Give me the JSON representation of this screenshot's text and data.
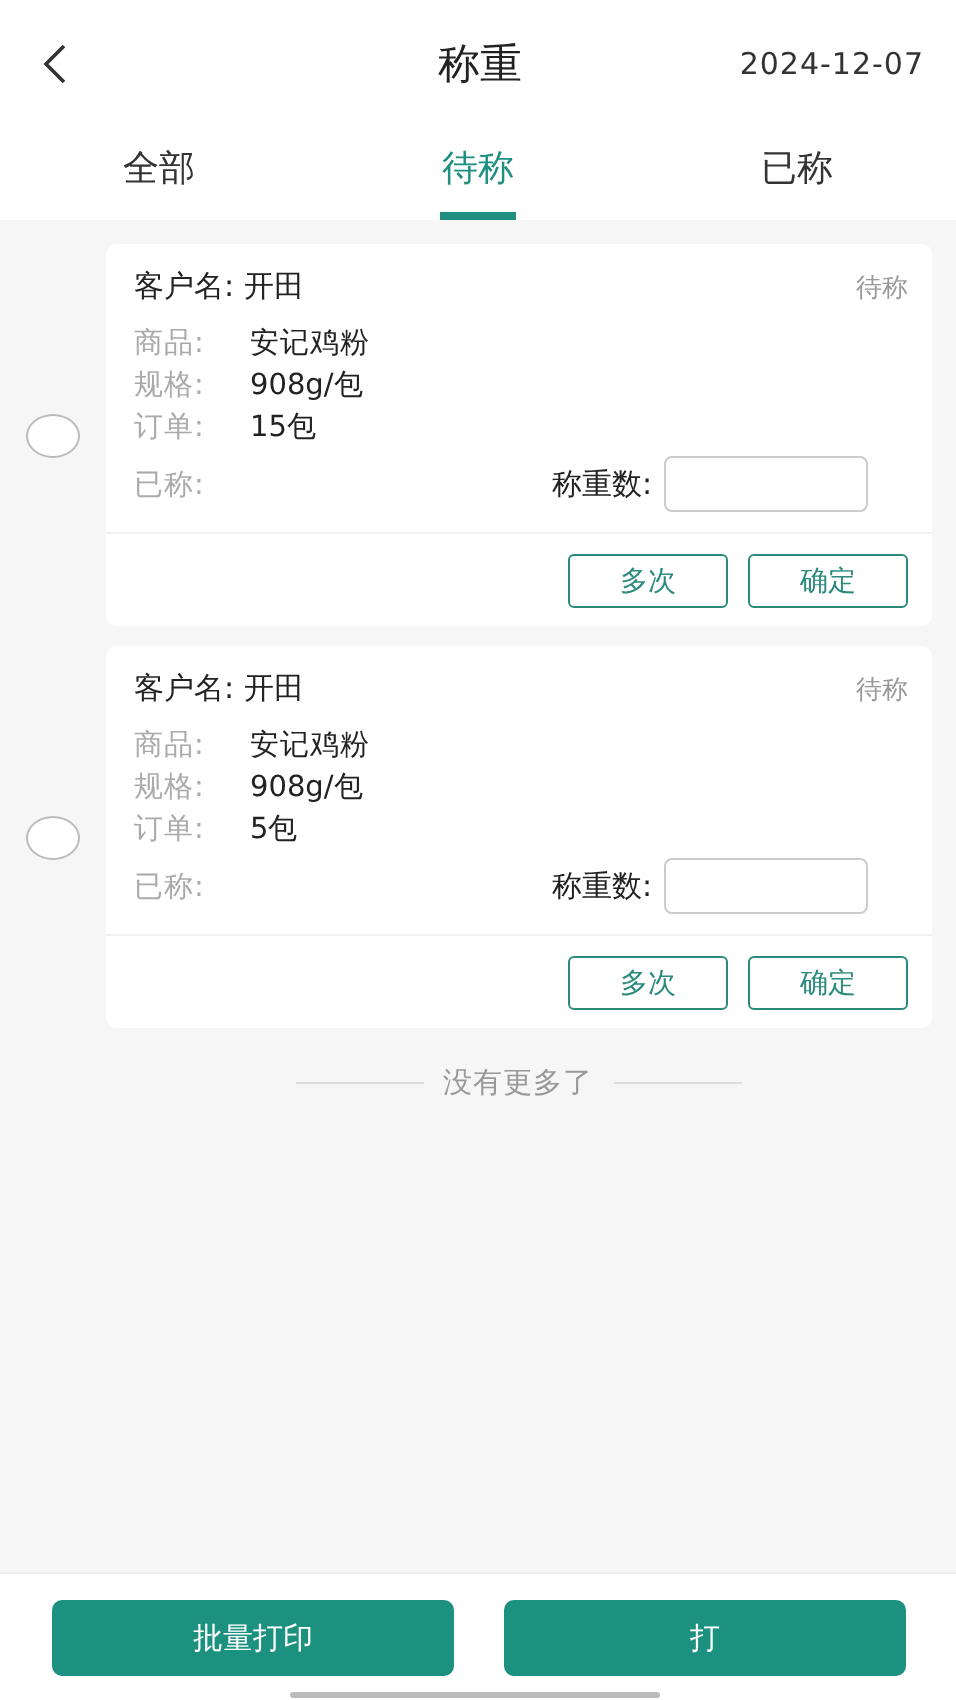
{
  "header": {
    "title": "称重",
    "date": "2024-12-07"
  },
  "tabs": [
    {
      "label": "全部",
      "selected": false
    },
    {
      "label": "待称",
      "selected": true
    },
    {
      "label": "已称",
      "selected": false
    }
  ],
  "orders": [
    {
      "selected": false,
      "customer_label": "客户名:",
      "customer": "开田",
      "status": "待称",
      "fields": [
        {
          "label": "商品:",
          "value": "安记鸡粉"
        },
        {
          "label": "规格:",
          "value": "908g/包"
        },
        {
          "label": "订单:",
          "value": "15包"
        }
      ],
      "weighed_label": "已称:",
      "weight_label": "称重数:",
      "buttons": [
        "多次",
        "确定"
      ]
    },
    {
      "selected": false,
      "customer_label": "客户名:",
      "customer": "开田",
      "status": "待称",
      "fields": [
        {
          "label": "商品:",
          "value": "安记鸡粉"
        },
        {
          "label": "规格:",
          "value": "908g/包"
        },
        {
          "label": "订单:",
          "value": "5包"
        }
      ],
      "weighed_label": "已称:",
      "weight_label": "称重数:",
      "buttons": [
        "多次",
        "确定"
      ]
    }
  ],
  "end_note": "没有更多了",
  "footer_buttons": [
    "批量打印",
    "打"
  ]
}
